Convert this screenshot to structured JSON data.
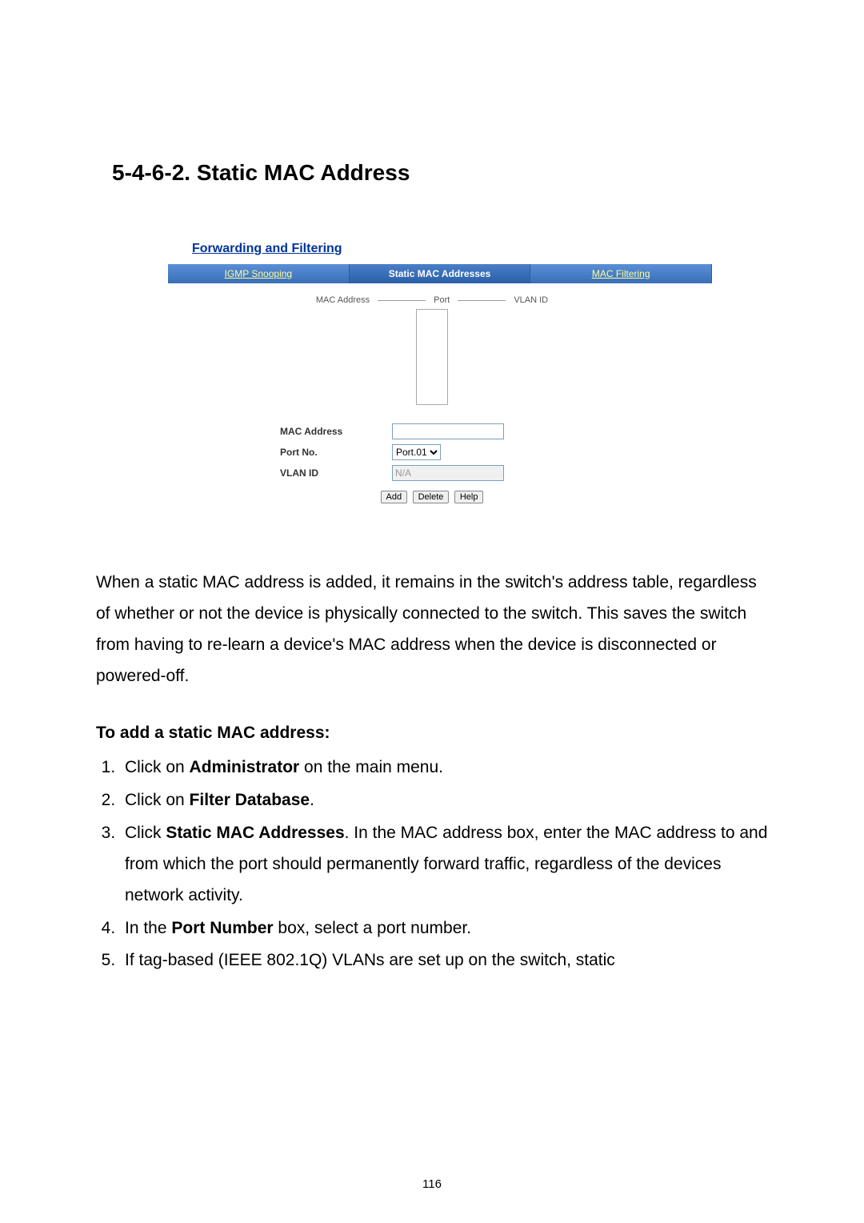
{
  "heading": "5-4-6-2. Static MAC Address",
  "panel": {
    "title": "Forwarding and Filtering",
    "tabs": {
      "igmp": "IGMP Snooping",
      "static": "Static MAC Addresses",
      "filter": "MAC Filtering"
    },
    "midlabels": {
      "mac": "MAC Address",
      "port": "Port",
      "vlan": "VLAN ID"
    },
    "form": {
      "mac_label": "MAC Address",
      "port_label": "Port No.",
      "port_value": "Port.01",
      "vlan_label": "VLAN ID",
      "vlan_value": "N/A"
    },
    "buttons": {
      "add": "Add",
      "delete": "Delete",
      "help": "Help"
    }
  },
  "paragraph": "When a static MAC address is added, it remains in the switch's address table, regardless of whether or not the device is physically connected to the switch. This saves the switch from having to re-learn a device's MAC address when the device is disconnected or powered-off.",
  "subheading": "To add a static MAC address:",
  "steps": {
    "s1a": "Click on ",
    "s1b": "Administrator",
    "s1c": " on the main menu.",
    "s2a": "Click on ",
    "s2b": "Filter Database",
    "s2c": ".",
    "s3a": "Click ",
    "s3b": "Static MAC Addresses",
    "s3c": ". In the MAC address box, enter the MAC address to and from which the port should permanently forward traffic, regardless of the devices network activity.",
    "s4a": "In the ",
    "s4b": "Port Number",
    "s4c": " box, select a port number.",
    "s5": "If tag-based (IEEE 802.1Q) VLANs are set up on the switch, static"
  },
  "page_number": "116"
}
